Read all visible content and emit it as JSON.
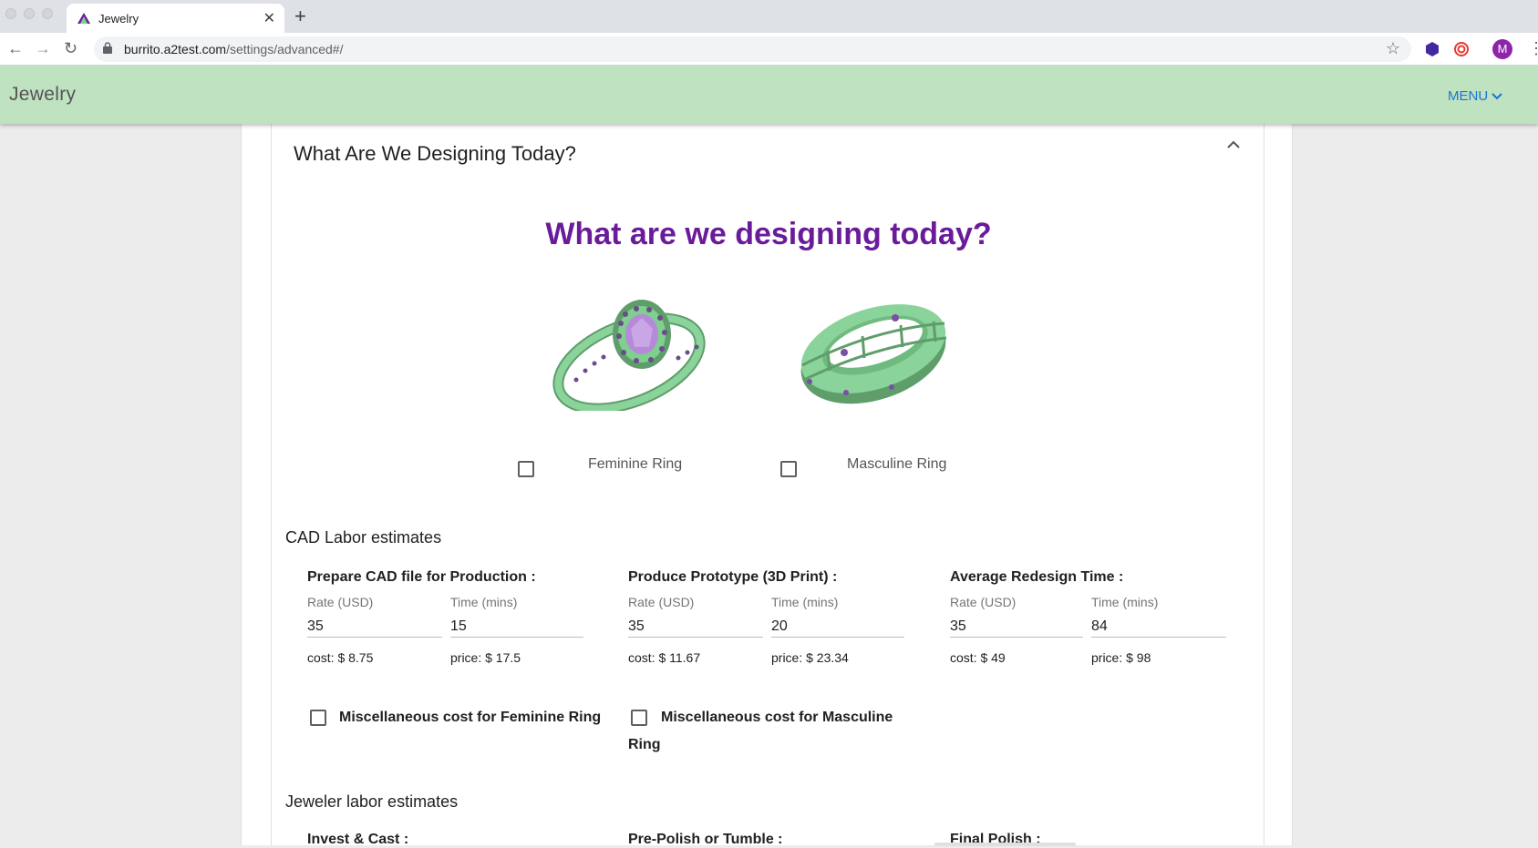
{
  "browser": {
    "tab_title": "Jewelry",
    "url_host": "burrito.a2test.com",
    "url_path": "/settings/advanced#/",
    "profile_initial": "M"
  },
  "app": {
    "brand": "Jewelry",
    "menu_label": "MENU"
  },
  "section": {
    "title": "What Are We Designing Today?",
    "hero": "What are we designing today?"
  },
  "choices": {
    "feminine": {
      "label": "Feminine Ring",
      "checked": false
    },
    "masculine": {
      "label": "Masculine Ring",
      "checked": false
    }
  },
  "cad": {
    "heading": "CAD Labor estimates",
    "rate_label": "Rate (USD)",
    "time_label": "Time (mins)",
    "groups": [
      {
        "title": "Prepare CAD file for Production :",
        "rate": "35",
        "time": "15",
        "cost": "cost: $ 8.75",
        "price": "price: $ 17.5"
      },
      {
        "title": "Produce Prototype (3D Print) :",
        "rate": "35",
        "time": "20",
        "cost": "cost: $ 11.67",
        "price": "price: $ 23.34"
      },
      {
        "title": "Average Redesign Time :",
        "rate": "35",
        "time": "84",
        "cost": "cost: $ 49",
        "price": "price: $ 98"
      }
    ],
    "misc": {
      "feminine": "Miscellaneous cost for Feminine Ring",
      "masculine_line1": "Miscellaneous cost for Masculine",
      "masculine_line2": "Ring"
    }
  },
  "jeweler": {
    "heading": "Jeweler labor estimates",
    "groups": [
      "Invest & Cast :",
      "Pre-Polish or Tumble :",
      "Final Polish :"
    ]
  },
  "colors": {
    "appbar": "#bfe2c0",
    "hero": "#6a1b9a",
    "menu": "#1976d2",
    "ring_green": "#7fcf8e",
    "gem_purple": "#b58ad8"
  }
}
